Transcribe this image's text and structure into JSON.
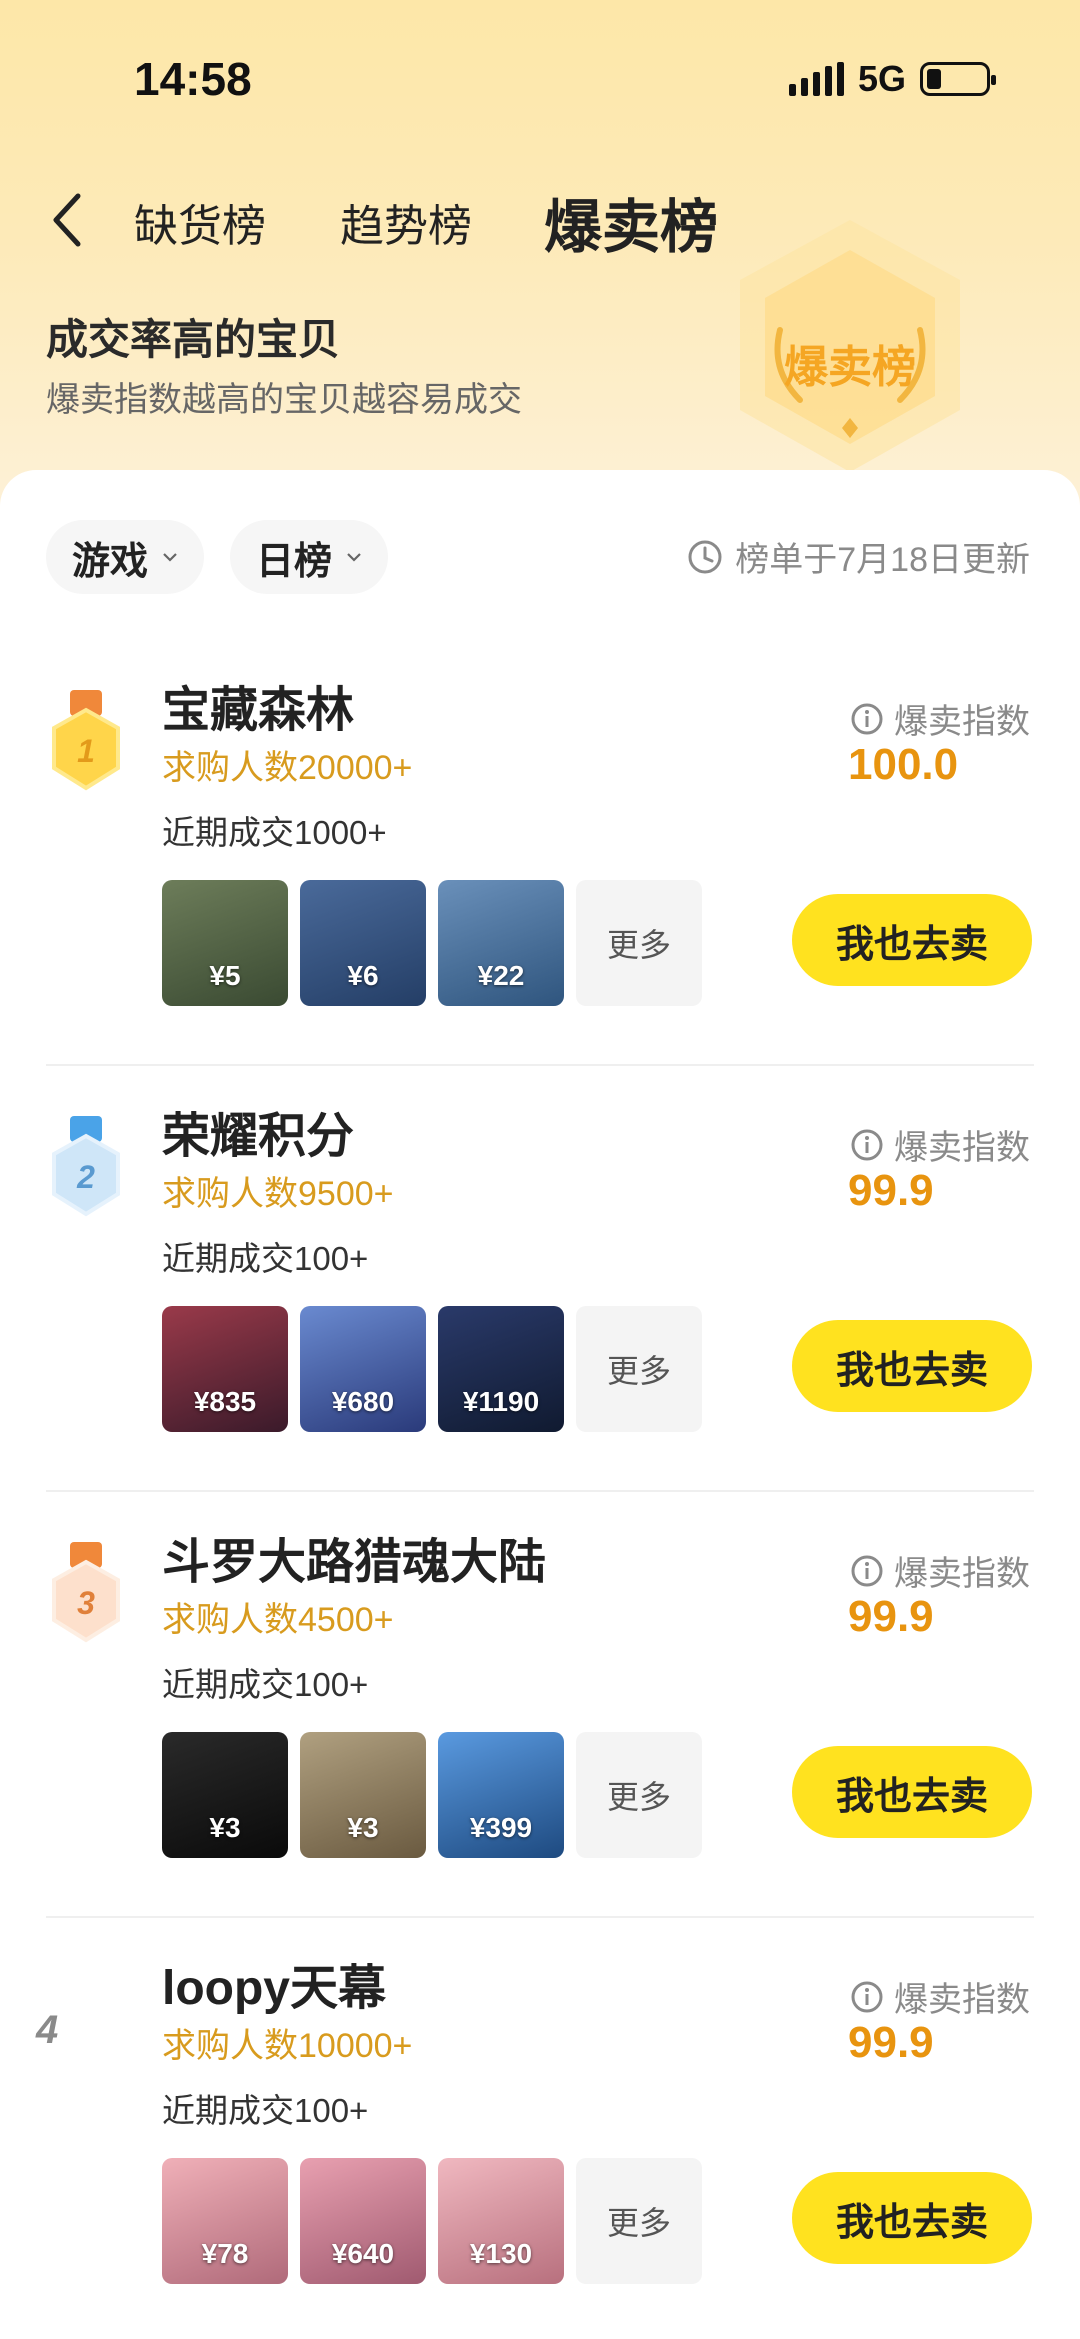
{
  "status": {
    "time": "14:58",
    "network": "5G"
  },
  "nav": {
    "tabs": [
      {
        "label": "缺货榜"
      },
      {
        "label": "趋势榜"
      },
      {
        "label": "爆卖榜"
      }
    ]
  },
  "hero": {
    "title": "成交率高的宝贝",
    "subtitle": "爆卖指数越高的宝贝越容易成交",
    "badge_text": "爆卖榜"
  },
  "filters": {
    "category": "游戏",
    "period": "日榜",
    "update_text": "榜单于7月18日更新"
  },
  "labels": {
    "index_label": "爆卖指数",
    "more": "更多",
    "sell_button": "我也去卖"
  },
  "items": [
    {
      "rank": "1",
      "name": "宝藏森林",
      "buyers": "求购人数20000+",
      "recent": "近期成交1000+",
      "index": "100.0",
      "thumbs": [
        {
          "price": "¥5",
          "color": "#4b5a3e"
        },
        {
          "price": "¥6",
          "color": "#2f4d7a"
        },
        {
          "price": "¥22",
          "color": "#4a6f9a"
        }
      ]
    },
    {
      "rank": "2",
      "name": "荣耀积分",
      "buyers": "求购人数9500+",
      "recent": "近期成交100+",
      "index": "99.9",
      "thumbs": [
        {
          "price": "¥835",
          "color": "#6b2a3a"
        },
        {
          "price": "¥680",
          "color": "#3d5a9a"
        },
        {
          "price": "¥1190",
          "color": "#1e2a4a"
        }
      ]
    },
    {
      "rank": "3",
      "name": "斗罗大路猎魂大陆",
      "buyers": "求购人数4500+",
      "recent": "近期成交100+",
      "index": "99.9",
      "thumbs": [
        {
          "price": "¥3",
          "color": "#1a1a1a"
        },
        {
          "price": "¥3",
          "color": "#8a7a60"
        },
        {
          "price": "¥399",
          "color": "#2f6fb0"
        }
      ]
    },
    {
      "rank": "4",
      "name": "loopy天幕",
      "buyers": "求购人数10000+",
      "recent": "近期成交100+",
      "index": "99.9",
      "thumbs": [
        {
          "price": "¥78",
          "color": "#d98f9a"
        },
        {
          "price": "¥640",
          "color": "#c97a8a"
        },
        {
          "price": "¥130",
          "color": "#d5909c"
        }
      ]
    }
  ]
}
